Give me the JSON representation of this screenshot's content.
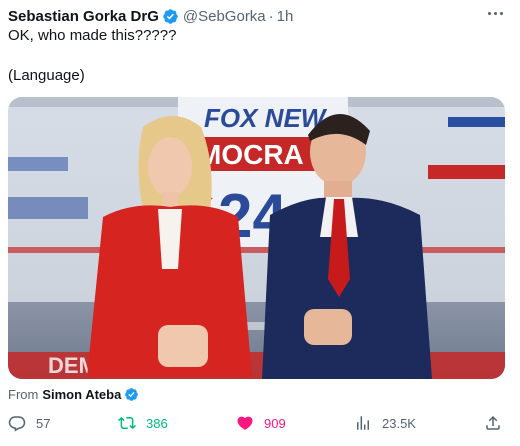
{
  "post": {
    "author_name": "Sebastian Gorka DrG",
    "handle": "@SebGorka",
    "separator": "·",
    "time": "1h",
    "text_line1": "OK, who made this?????",
    "text_line2": "(Language)"
  },
  "media": {
    "banner_text": "FOX NEW",
    "banner_sub": "MOCRA",
    "banner_year": "24",
    "floor_text": "DEMOCRACY"
  },
  "attribution": {
    "prefix": "From",
    "source_name": "Simon Ateba"
  },
  "actions": {
    "replies": "57",
    "reposts": "386",
    "likes": "909",
    "views": "23.5K"
  },
  "colors": {
    "verified_blue": "#1d9bf0",
    "repost_green": "#00ba7c",
    "like_pink": "#f91880",
    "muted": "#536471"
  },
  "icons": {
    "verified": "verified-badge-icon",
    "more": "more-icon",
    "reply": "reply-icon",
    "repost": "repost-icon",
    "like": "heart-icon",
    "views": "views-icon",
    "share": "share-icon"
  }
}
